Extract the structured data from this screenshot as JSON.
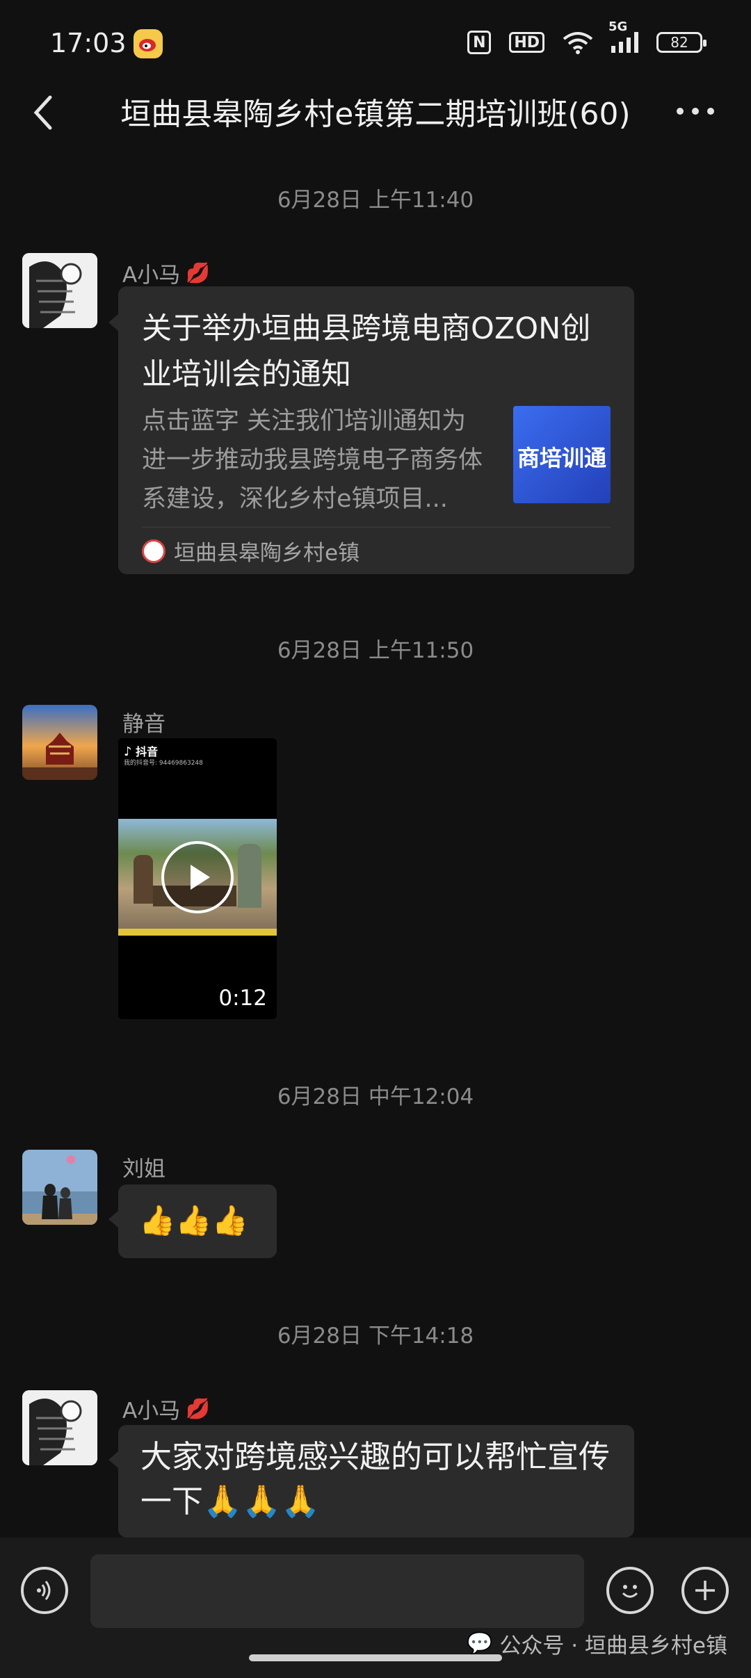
{
  "status_bar": {
    "time": "17:03",
    "network": "5G",
    "battery": "82"
  },
  "header": {
    "title": "垣曲县皋陶乡村e镇第二期培训班(60)"
  },
  "messages": [
    {
      "timestamp": "6月28日 上午11:40",
      "sender": "A小马",
      "article": {
        "title": "关于举办垣曲县跨境电商OZON创业培训会的通知",
        "desc": "点击蓝字 关注我们培训通知为进一步推动我县跨境电子商务体系建设，深化乡村e镇项目...",
        "thumb_text": "商培训通",
        "source": "垣曲县皋陶乡村e镇"
      }
    },
    {
      "timestamp": "6月28日 上午11:50",
      "sender": "静音",
      "video": {
        "platform": "抖音",
        "account": "我的抖音号: 94469863248",
        "duration": "0:12"
      }
    },
    {
      "timestamp": "6月28日 中午12:04",
      "sender": "刘姐",
      "text": "👍👍👍"
    },
    {
      "timestamp": "6月28日 下午14:18",
      "sender": "A小马",
      "text": "大家对跨境感兴趣的可以帮忙宣传一下🙏🙏🙏"
    }
  ],
  "watermark": "公众号 · 垣曲县乡村e镇",
  "colors": {
    "background": "#111111",
    "bubble": "#2b2b2b",
    "accent_blue": "#2f5bd8"
  }
}
